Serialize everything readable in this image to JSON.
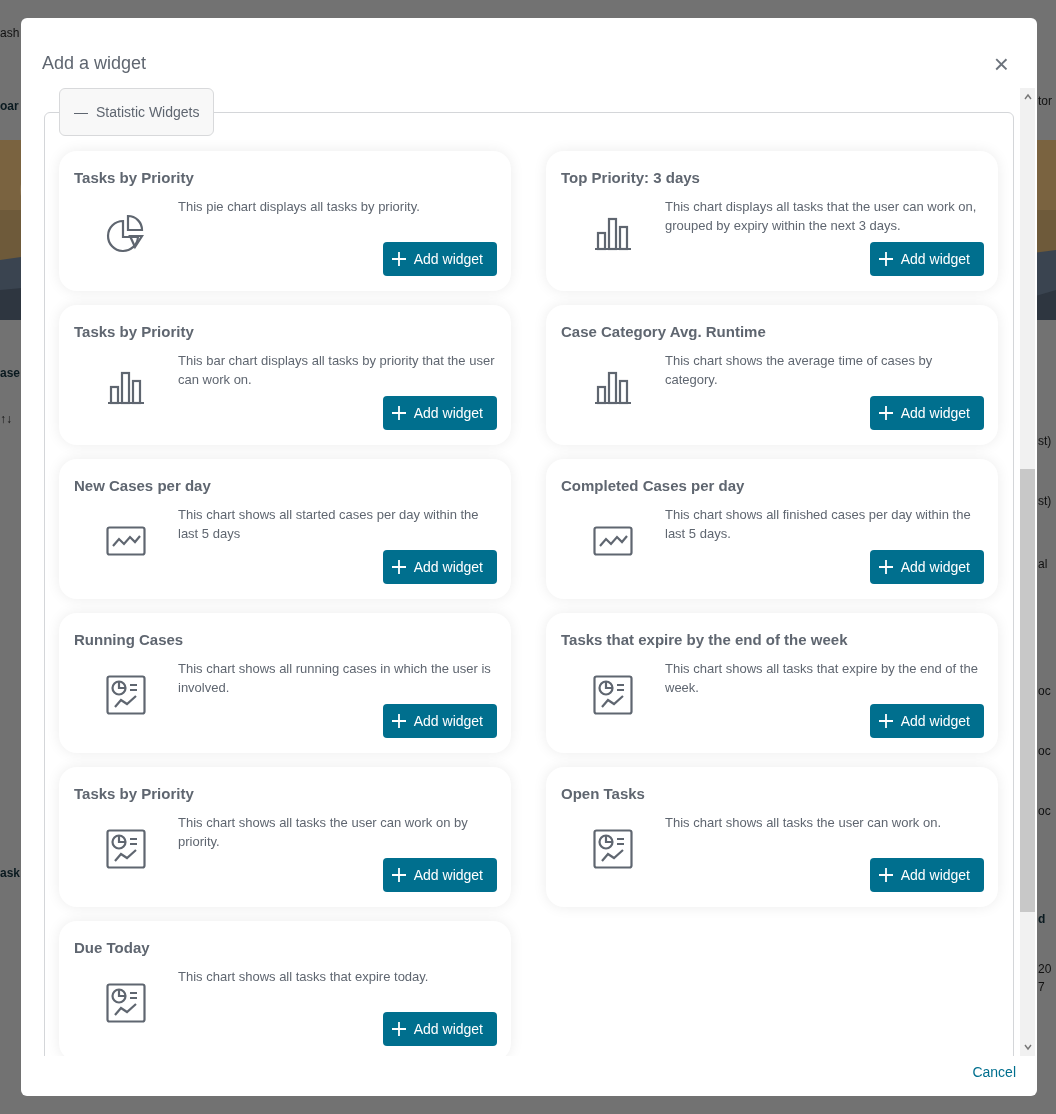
{
  "background_page": {
    "left_fragments": [
      "ash",
      "oar",
      "ase",
      "↑↓",
      "ask"
    ],
    "right_fragments": [
      "tor",
      "st)",
      "st)",
      "al",
      "oc",
      "oc",
      "oc",
      "d",
      "20",
      "7"
    ]
  },
  "dialog": {
    "title": "Add a widget",
    "close": "×",
    "section": {
      "toggle": "—",
      "label": "Statistic Widgets",
      "expanded": true
    },
    "widgets": [
      {
        "title": "Tasks by Priority",
        "kind": "pie",
        "description": "This pie chart displays all tasks by priority.",
        "button": "Add widget"
      },
      {
        "title": "Top Priority: 3 days",
        "kind": "bar",
        "description": "This chart displays all tasks that the user can work on, grouped by expiry within the next 3 days.",
        "button": "Add widget"
      },
      {
        "title": "Tasks by Priority",
        "kind": "bar",
        "description": "This bar chart displays all tasks by priority that the user can work on.",
        "button": "Add widget"
      },
      {
        "title": "Case Category Avg. Runtime",
        "kind": "bar",
        "description": "This chart shows the average time of cases by category.",
        "button": "Add widget"
      },
      {
        "title": "New Cases per day",
        "kind": "line",
        "description": "This chart shows all started cases per day within the last 5 days",
        "button": "Add widget"
      },
      {
        "title": "Completed Cases per day",
        "kind": "line",
        "description": "This chart shows all finished cases per day within the last 5 days.",
        "button": "Add widget"
      },
      {
        "title": "Running Cases",
        "kind": "report",
        "description": "This chart shows all running cases in which the user is involved.",
        "button": "Add widget"
      },
      {
        "title": "Tasks that expire by the end of the week",
        "kind": "report",
        "description": "This chart shows all tasks that expire by the end of the week.",
        "button": "Add widget"
      },
      {
        "title": "Tasks by Priority",
        "kind": "report",
        "description": "This chart shows all tasks the user can work on by priority.",
        "button": "Add widget"
      },
      {
        "title": "Open Tasks",
        "kind": "report",
        "description": "This chart shows all tasks the user can work on.",
        "button": "Add widget"
      },
      {
        "title": "Due Today",
        "kind": "report",
        "description": "This chart shows all tasks that expire today.",
        "button": "Add widget"
      }
    ],
    "cancel": "Cancel"
  }
}
